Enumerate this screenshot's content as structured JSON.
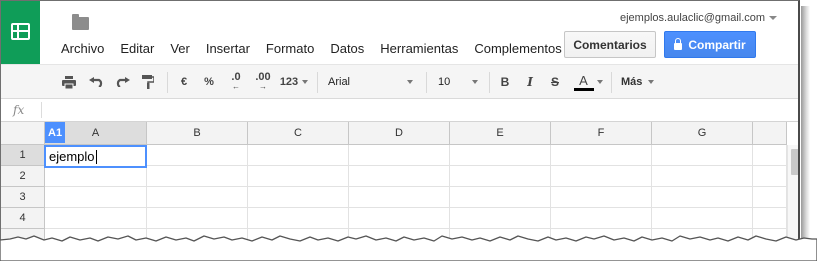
{
  "account": {
    "email": "ejemplos.aulaclic@gmail.com"
  },
  "menu": [
    "Archivo",
    "Editar",
    "Ver",
    "Insertar",
    "Formato",
    "Datos",
    "Herramientas",
    "Complementos"
  ],
  "buttons": {
    "comments": "Comentarios",
    "share": "Compartir"
  },
  "toolbar": {
    "currency": "€",
    "percent": "%",
    "decimal_less": ".0",
    "decimal_more": ".00",
    "number_format": "123",
    "font": "Arial",
    "font_size": "10",
    "bold": "B",
    "italic": "I",
    "strike": "S",
    "text_color": "A",
    "more": "Más"
  },
  "formula_bar": {
    "fx": "fx",
    "content": ""
  },
  "sheet": {
    "active_cell": "A1",
    "columns": [
      "A",
      "B",
      "C",
      "D",
      "E",
      "F",
      "G"
    ],
    "rows": [
      "1",
      "2",
      "3",
      "4"
    ],
    "cell_A1": "ejemplo"
  },
  "colors": {
    "brand": "#0f9d58",
    "share_button": "#4d90fe",
    "selection": "#4d90fe"
  },
  "icons": [
    "sheets-logo-icon",
    "folder-icon",
    "print-icon",
    "undo-icon",
    "redo-icon",
    "paint-format-icon",
    "lock-icon",
    "text-color-icon"
  ]
}
